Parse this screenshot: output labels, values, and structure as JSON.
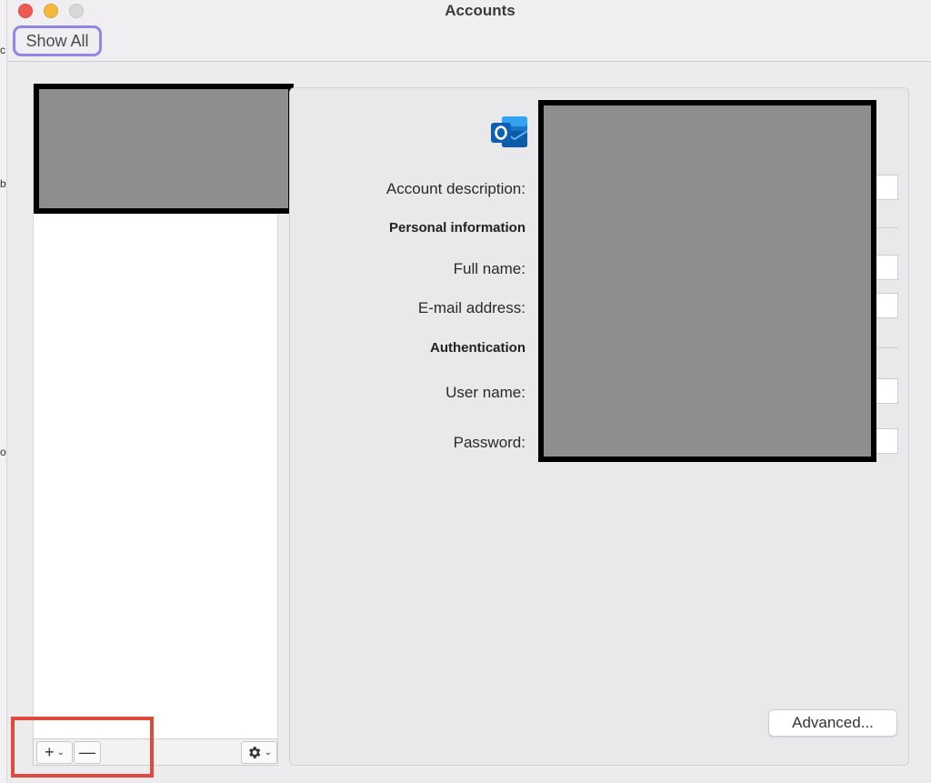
{
  "window": {
    "title": "Accounts",
    "show_all_label": "Show All"
  },
  "background_window": {
    "fragments": [
      "c",
      "b",
      "o"
    ]
  },
  "account_list": {
    "add_label": "+",
    "remove_label": "—",
    "chevron": "⌄",
    "gear_icon": "gear-icon"
  },
  "account_details": {
    "icon": "outlook-icon",
    "fields": {
      "account_description": "Account description:",
      "personal_information": "Personal information",
      "full_name": "Full name:",
      "email_address": "E-mail address:",
      "authentication": "Authentication",
      "user_name": "User name:",
      "password": "Password:"
    },
    "advanced_label": "Advanced..."
  },
  "colors": {
    "highlight_show_all": "#8f86e8",
    "highlight_add_remove": "#e0493c",
    "redaction": "#8e8e8e"
  }
}
